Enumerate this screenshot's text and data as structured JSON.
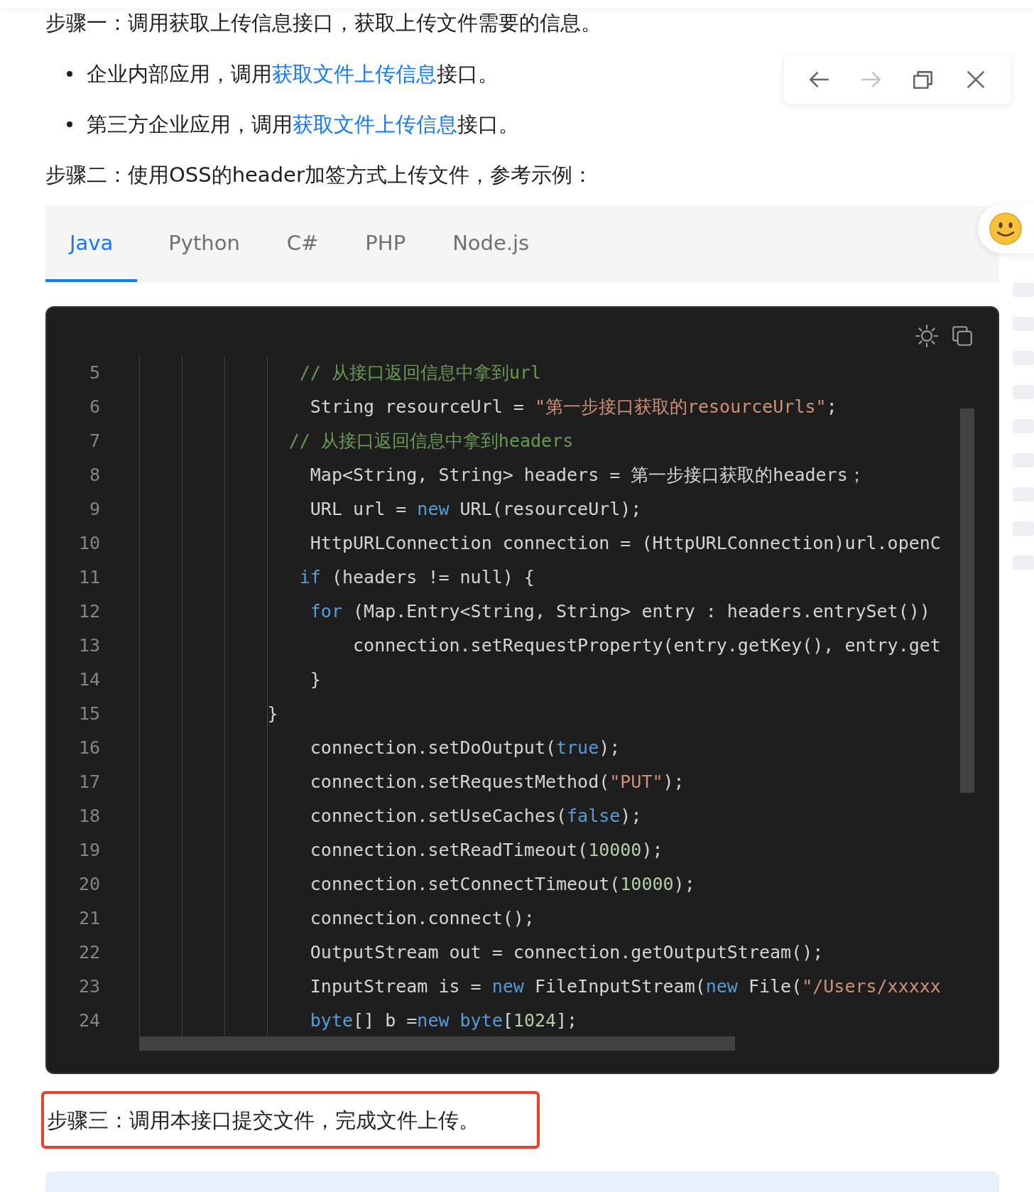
{
  "step_1": "步骤一：调用获取上传信息接口，获取上传文件需要的信息。",
  "bullets": [
    {
      "before": "企业内部应用，调用",
      "link": "获取文件上传信息",
      "after": "接口。"
    },
    {
      "before": "第三方企业应用，调用",
      "link": "获取文件上传信息",
      "after": "接口。"
    }
  ],
  "step_2": "步骤二：使用OSS的header加签方式上传文件，参考示例：",
  "code_tabs": [
    {
      "label": "Java",
      "selected": true
    },
    {
      "label": "Python",
      "selected": false
    },
    {
      "label": "C#",
      "selected": false
    },
    {
      "label": "PHP",
      "selected": false
    },
    {
      "label": "Node.js",
      "selected": false
    }
  ],
  "code_lines": [
    {
      "number": "5",
      "tokens": [
        {
          "kind": "comment",
          "text": "               // 从接口返回信息中拿到url"
        }
      ]
    },
    {
      "number": "6",
      "tokens": [
        {
          "kind": "plain",
          "text": "                String resourceUrl = "
        },
        {
          "kind": "string",
          "text": "\"第一步接口获取的resourceUrls\""
        },
        {
          "kind": "plain",
          "text": ";"
        }
      ]
    },
    {
      "number": "7",
      "tokens": [
        {
          "kind": "comment",
          "text": "              // 从接口返回信息中拿到headers"
        }
      ]
    },
    {
      "number": "8",
      "tokens": [
        {
          "kind": "plain",
          "text": "                Map<String, String> headers = 第一步接口获取的headers；"
        }
      ]
    },
    {
      "number": "9",
      "tokens": [
        {
          "kind": "plain",
          "text": "                URL url = "
        },
        {
          "kind": "keyword",
          "text": "new"
        },
        {
          "kind": "plain",
          "text": " URL(resourceUrl);"
        }
      ]
    },
    {
      "number": "10",
      "tokens": [
        {
          "kind": "plain",
          "text": "                HttpURLConnection connection = (HttpURLConnection)url.openC"
        }
      ]
    },
    {
      "number": "11",
      "tokens": [
        {
          "kind": "keyword",
          "text": "               if"
        },
        {
          "kind": "plain",
          "text": " (headers != null) {"
        }
      ]
    },
    {
      "number": "12",
      "tokens": [
        {
          "kind": "keyword",
          "text": "                for"
        },
        {
          "kind": "plain",
          "text": " (Map.Entry<String, String> entry : headers.entrySet())"
        }
      ]
    },
    {
      "number": "13",
      "tokens": [
        {
          "kind": "plain",
          "text": "                    connection.setRequestProperty(entry.getKey(), entry.get"
        }
      ]
    },
    {
      "number": "14",
      "tokens": [
        {
          "kind": "plain",
          "text": "                }"
        }
      ]
    },
    {
      "number": "15",
      "tokens": [
        {
          "kind": "plain",
          "text": "            }"
        }
      ]
    },
    {
      "number": "16",
      "tokens": [
        {
          "kind": "plain",
          "text": "                connection.setDoOutput("
        },
        {
          "kind": "keyword",
          "text": "true"
        },
        {
          "kind": "plain",
          "text": ");"
        }
      ]
    },
    {
      "number": "17",
      "tokens": [
        {
          "kind": "plain",
          "text": "                connection.setRequestMethod("
        },
        {
          "kind": "string",
          "text": "\"PUT\""
        },
        {
          "kind": "plain",
          "text": ");"
        }
      ]
    },
    {
      "number": "18",
      "tokens": [
        {
          "kind": "plain",
          "text": "                connection.setUseCaches("
        },
        {
          "kind": "keyword",
          "text": "false"
        },
        {
          "kind": "plain",
          "text": ");"
        }
      ]
    },
    {
      "number": "19",
      "tokens": [
        {
          "kind": "plain",
          "text": "                connection.setReadTimeout("
        },
        {
          "kind": "number",
          "text": "10000"
        },
        {
          "kind": "plain",
          "text": ");"
        }
      ]
    },
    {
      "number": "20",
      "tokens": [
        {
          "kind": "plain",
          "text": "                connection.setConnectTimeout("
        },
        {
          "kind": "number",
          "text": "10000"
        },
        {
          "kind": "plain",
          "text": ");"
        }
      ]
    },
    {
      "number": "21",
      "tokens": [
        {
          "kind": "plain",
          "text": "                connection.connect();"
        }
      ]
    },
    {
      "number": "22",
      "tokens": [
        {
          "kind": "plain",
          "text": "                OutputStream out = connection.getOutputStream();"
        }
      ]
    },
    {
      "number": "23",
      "tokens": [
        {
          "kind": "plain",
          "text": "                InputStream is = "
        },
        {
          "kind": "keyword",
          "text": "new"
        },
        {
          "kind": "plain",
          "text": " FileInputStream("
        },
        {
          "kind": "keyword",
          "text": "new"
        },
        {
          "kind": "plain",
          "text": " File("
        },
        {
          "kind": "string",
          "text": "\"/Users/xxxxx"
        }
      ]
    },
    {
      "number": "24",
      "tokens": [
        {
          "kind": "keyword",
          "text": "                byte"
        },
        {
          "kind": "plain",
          "text": "[] b ="
        },
        {
          "kind": "keyword",
          "text": "new"
        },
        {
          "kind": "keyword",
          "text": " byte"
        },
        {
          "kind": "plain",
          "text": "["
        },
        {
          "kind": "number",
          "text": "1024"
        },
        {
          "kind": "plain",
          "text": "];"
        }
      ]
    }
  ],
  "step_3": {
    "text": "步骤三：调用本接口提交文件，完成文件上传。",
    "highlighted": true
  },
  "nav_buttons": [
    {
      "kind": "back",
      "disabled": false
    },
    {
      "kind": "forward",
      "disabled": true
    },
    {
      "kind": "restore",
      "disabled": false
    },
    {
      "kind": "close",
      "disabled": false
    }
  ]
}
